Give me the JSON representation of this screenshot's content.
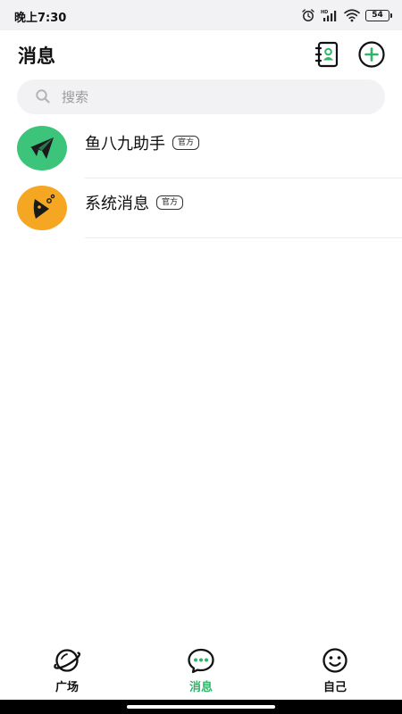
{
  "status_bar": {
    "time": "晚上7:30",
    "battery": "54"
  },
  "header": {
    "title": "消息"
  },
  "search": {
    "placeholder": "搜索"
  },
  "chats": [
    {
      "name": "鱼八九助手",
      "badge": "官方",
      "avatar_color": "#3cc47a",
      "avatar_icon": "paper-plane-fish-icon"
    },
    {
      "name": "系统消息",
      "badge": "官方",
      "avatar_color": "#f5a623",
      "avatar_icon": "fish-head-icon"
    }
  ],
  "bottom_nav": [
    {
      "label": "广场",
      "icon": "planet-icon",
      "active": false
    },
    {
      "label": "消息",
      "icon": "chat-bubble-icon",
      "active": true
    },
    {
      "label": "自己",
      "icon": "smiley-icon",
      "active": false
    }
  ],
  "colors": {
    "accent": "#32b36a",
    "search_bg": "#f2f2f4",
    "status_bg": "#f2f2f4"
  }
}
